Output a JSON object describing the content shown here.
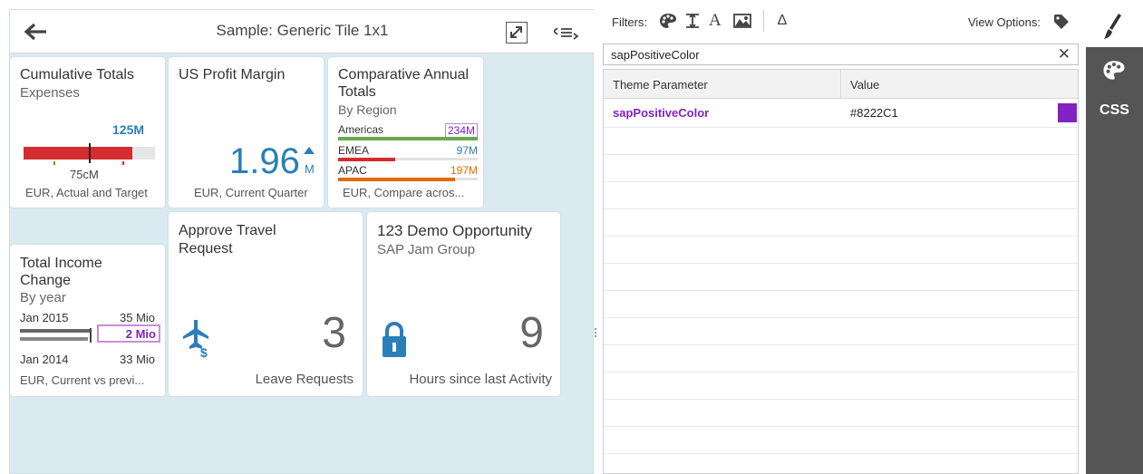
{
  "header": {
    "title": "Sample: Generic Tile 1x1"
  },
  "tiles": {
    "cumulative": {
      "title": "Cumulative Totals",
      "subtitle": "Expenses",
      "value": "125M",
      "target": "75cM",
      "footer": "EUR, Actual and Target"
    },
    "profit": {
      "title": "US Profit Margin",
      "value": "1.96",
      "unit": "M",
      "footer": "EUR, Current Quarter"
    },
    "comparative": {
      "title_line1": "Comparative Annual",
      "title_line2": "Totals",
      "subtitle": "By Region",
      "rows": [
        {
          "name": "Americas",
          "value": "234M",
          "color": "#8222C1",
          "bar_color": "#6aa84f",
          "fraction": 1.0
        },
        {
          "name": "EMEA",
          "value": "97M",
          "color": "#2a7fb8",
          "bar_color": "#d42c2f",
          "fraction": 0.41
        },
        {
          "name": "APAC",
          "value": "197M",
          "color": "#e06d00",
          "bar_color": "#e06d00",
          "fraction": 0.84
        }
      ],
      "footer": "EUR, Compare acros..."
    },
    "income": {
      "title_line1": "Total Income",
      "title_line2": "Change",
      "subtitle": "By year",
      "row1_label": "Jan 2015",
      "row1_value": "35 Mio",
      "diff": "2 Mio",
      "row2_label": "Jan 2014",
      "row2_value": "33 Mio",
      "footer": "EUR, Current vs previ..."
    },
    "travel": {
      "title_line1": "Approve Travel",
      "title_line2": "Request",
      "value": "3",
      "footer": "Leave Requests"
    },
    "opportunity": {
      "title": "123 Demo Opportunity",
      "subtitle": "SAP Jam Group",
      "value": "9",
      "footer": "Hours since last Activity"
    }
  },
  "panel": {
    "filters_label": "Filters:",
    "filter_icons": [
      "palette-icon",
      "text-height-icon",
      "font-icon",
      "image-icon",
      "delta-icon"
    ],
    "view_options_label": "View Options:",
    "search_value": "sapPositiveColor",
    "columns": [
      "Theme Parameter",
      "Value"
    ],
    "rows": [
      {
        "parameter": "sapPositiveColor",
        "value": "#8222C1"
      }
    ]
  },
  "sidebar": {
    "css_label": "CSS"
  },
  "colors": {
    "positive": "#8222C1",
    "accent": "#2a7fb8",
    "background": "#dbeaf1",
    "sidebar": "#555555"
  }
}
